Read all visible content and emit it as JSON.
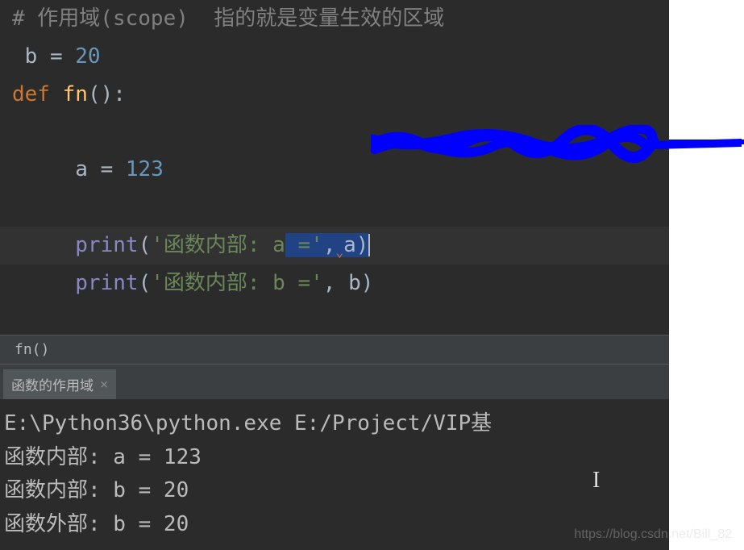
{
  "editor": {
    "line1": {
      "marker": "#",
      "comment": " 作用域(scope)  指的就是变量生效的区域"
    },
    "line2": {
      "indent": " ",
      "var": "b",
      "op": " = ",
      "val": "20"
    },
    "line3": {
      "keyword": "def",
      "space": " ",
      "func": "fn",
      "parens": "():"
    },
    "line5": {
      "indent": "     ",
      "var": "a",
      "op": " = ",
      "val": "123"
    },
    "line7": {
      "indent": "     ",
      "builtin": "print",
      "open": "(",
      "str1": "'函数内部: a",
      "selected": " ='",
      "comma": ",",
      "selected2": "a)",
      "close": ""
    },
    "line8": {
      "indent": "     ",
      "builtin": "print",
      "open": "(",
      "str": "'函数内部: b ='",
      "comma": ", ",
      "var": "b",
      "close": ")"
    }
  },
  "breadcrumb": {
    "text": "fn()"
  },
  "tab": {
    "label": "函数的作用域",
    "close": "×"
  },
  "console": {
    "line1": "E:\\Python36\\python.exe E:/Project/VIP基",
    "line2": "函数内部: a = 123",
    "line3": "函数内部: b = 20",
    "line4": "函数外部: b = 20"
  },
  "watermark": "https://blog.csdn.net/Bill_82"
}
